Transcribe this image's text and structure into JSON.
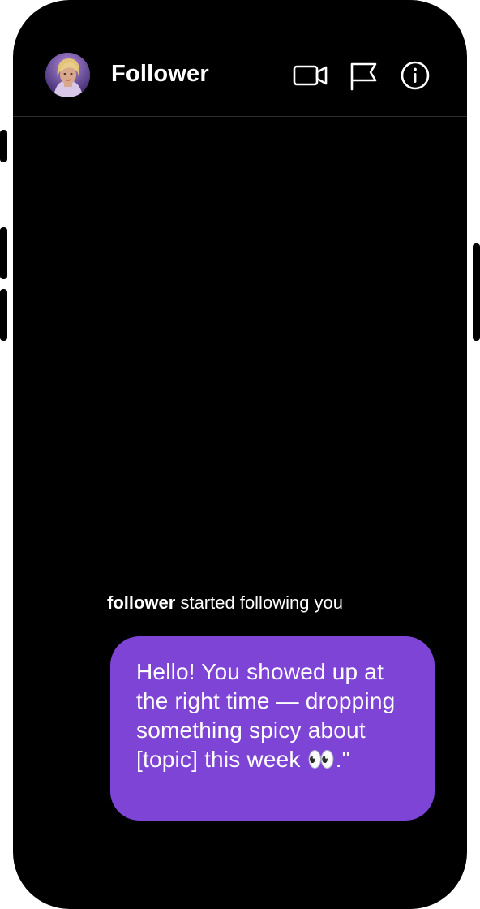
{
  "header": {
    "title": "Follower",
    "avatar_icon": "profile-avatar",
    "actions": [
      {
        "name": "video-call",
        "icon": "video-camera-icon"
      },
      {
        "name": "report",
        "icon": "flag-icon"
      },
      {
        "name": "info",
        "icon": "info-icon"
      }
    ]
  },
  "conversation": {
    "system_message": {
      "username": "follower",
      "text": " started following you"
    },
    "messages": [
      {
        "text": "Hello! You showed up at the right time — dropping something spicy about [topic] this week 👀.\""
      }
    ]
  },
  "colors": {
    "background": "#000000",
    "bubble": "#7e44d6",
    "text": "#ffffff",
    "divider": "#2e2e2e"
  }
}
